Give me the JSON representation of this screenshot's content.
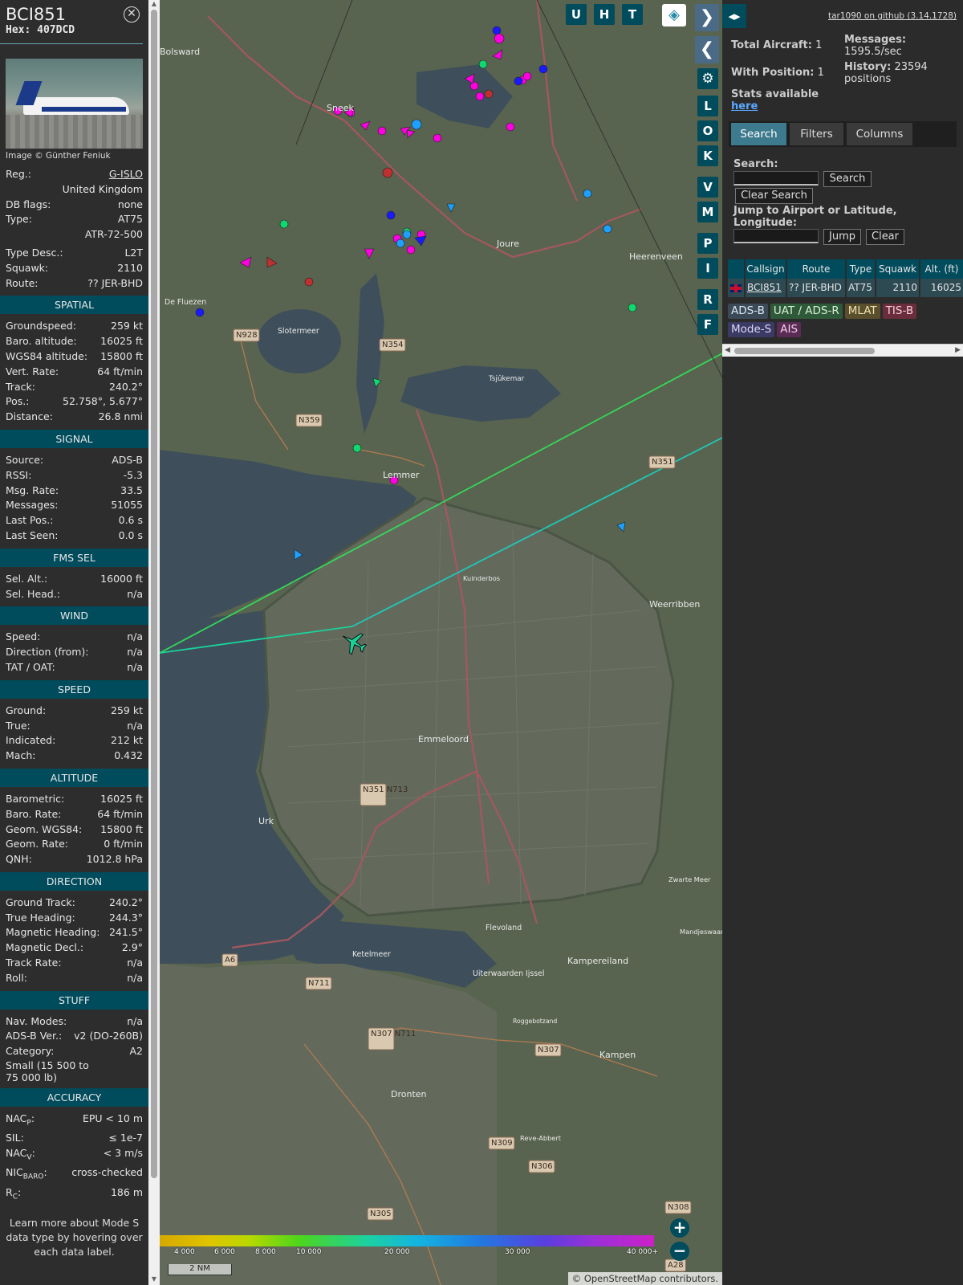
{
  "sidebar": {
    "callsign": "BCI851",
    "hex_label": "Hex:",
    "hex": "407DCD",
    "photo_credit": "Image © Günther Feniuk",
    "info": [
      {
        "k": "Reg.:",
        "v": "G-ISLO",
        "link": true
      },
      {
        "k": "",
        "v": "United Kingdom"
      },
      {
        "k": "DB flags:",
        "v": "none"
      },
      {
        "k": "Type:",
        "v": "AT75"
      },
      {
        "k": "",
        "v": "ATR-72-500"
      },
      {
        "k": "Type Desc.:",
        "v": "L2T"
      },
      {
        "k": "Squawk:",
        "v": "2110"
      },
      {
        "k": "Route:",
        "v": "?? JER-BHD"
      }
    ],
    "sections": [
      {
        "title": "SPATIAL",
        "rows": [
          {
            "k": "Groundspeed:",
            "v": "259 kt"
          },
          {
            "k": "Baro. altitude:",
            "v": "16025 ft"
          },
          {
            "k": "WGS84 altitude:",
            "v": "15800 ft"
          },
          {
            "k": "Vert. Rate:",
            "v": "64 ft/min"
          },
          {
            "k": "Track:",
            "v": "240.2°"
          },
          {
            "k": "Pos.:",
            "v": "52.758°, 5.677°"
          },
          {
            "k": "Distance:",
            "v": "26.8 nmi"
          }
        ]
      },
      {
        "title": "SIGNAL",
        "rows": [
          {
            "k": "Source:",
            "v": "ADS-B"
          },
          {
            "k": "RSSI:",
            "v": "-5.3"
          },
          {
            "k": "Msg. Rate:",
            "v": "33.5"
          },
          {
            "k": "Messages:",
            "v": "51055"
          },
          {
            "k": "Last Pos.:",
            "v": "0.6 s"
          },
          {
            "k": "Last Seen:",
            "v": "0.0 s"
          }
        ]
      },
      {
        "title": "FMS SEL",
        "rows": [
          {
            "k": "Sel. Alt.:",
            "v": "16000 ft"
          },
          {
            "k": "Sel. Head.:",
            "v": "n/a"
          }
        ]
      },
      {
        "title": "WIND",
        "rows": [
          {
            "k": "Speed:",
            "v": "n/a"
          },
          {
            "k": "Direction (from):",
            "v": "n/a"
          },
          {
            "k": "TAT / OAT:",
            "v": "n/a"
          }
        ]
      },
      {
        "title": "SPEED",
        "rows": [
          {
            "k": "Ground:",
            "v": "259 kt"
          },
          {
            "k": "True:",
            "v": "n/a"
          },
          {
            "k": "Indicated:",
            "v": "212 kt"
          },
          {
            "k": "Mach:",
            "v": "0.432"
          }
        ]
      },
      {
        "title": "ALTITUDE",
        "rows": [
          {
            "k": "Barometric:",
            "v": "16025 ft"
          },
          {
            "k": "Baro. Rate:",
            "v": "64 ft/min"
          },
          {
            "k": "Geom. WGS84:",
            "v": "15800 ft"
          },
          {
            "k": "Geom. Rate:",
            "v": "0 ft/min"
          },
          {
            "k": "QNH:",
            "v": "1012.8 hPa"
          }
        ]
      },
      {
        "title": "DIRECTION",
        "rows": [
          {
            "k": "Ground Track:",
            "v": "240.2°"
          },
          {
            "k": "True Heading:",
            "v": "244.3°"
          },
          {
            "k": "Magnetic Heading:",
            "v": "241.5°"
          },
          {
            "k": "Magnetic Decl.:",
            "v": "2.9°"
          },
          {
            "k": "Track Rate:",
            "v": "n/a"
          },
          {
            "k": "Roll:",
            "v": "n/a"
          }
        ]
      },
      {
        "title": "STUFF",
        "rows": [
          {
            "k": "Nav. Modes:",
            "v": "n/a"
          },
          {
            "k": "ADS-B Ver.:",
            "v": "v2 (DO-260B)"
          },
          {
            "k": "Category:",
            "v": "A2"
          }
        ]
      },
      {
        "title": "ACCURACY",
        "rows": [
          {
            "k": "NAC",
            "sub": "P",
            "v": "EPU < 10 m"
          },
          {
            "k": "SIL:",
            "v": "≤ 1e-7"
          },
          {
            "k": "NAC",
            "sub": "V",
            "v": "< 3 m/s"
          },
          {
            "k": "NIC",
            "sub": "BARO",
            "v": "cross-checked"
          },
          {
            "k": "R",
            "sub": "C",
            "v": "186 m"
          }
        ]
      }
    ],
    "category_desc": "Small (15 500 to 75 000 lb)",
    "note": "Learn more about Mode S data type by hovering over each data label."
  },
  "map": {
    "buttons_top": [
      "U",
      "H",
      "T"
    ],
    "buttons_side": [
      "L",
      "O",
      "K",
      "V",
      "M",
      "P",
      "I",
      "R",
      "F"
    ],
    "place_labels": [
      {
        "t": "Bolsward"
      },
      {
        "t": "Sneek"
      },
      {
        "t": "Joure"
      },
      {
        "t": "Heerenveen"
      },
      {
        "t": "Lemmer"
      },
      {
        "t": "Emmeloord"
      },
      {
        "t": "Urk"
      },
      {
        "t": "Dronten"
      },
      {
        "t": "Kampen"
      },
      {
        "t": "Kampereiland"
      },
      {
        "t": "Weerribben"
      },
      {
        "t": "Slotermeer"
      },
      {
        "t": "Tsjûkemar"
      },
      {
        "t": "De Fluezen"
      },
      {
        "t": "Ketelmeer"
      },
      {
        "t": "Flevoland"
      },
      {
        "t": "Uiterwaarden Ijssel"
      },
      {
        "t": "Roggebotzand"
      },
      {
        "t": "Reve-Abbert"
      },
      {
        "t": "Kuinderbos"
      },
      {
        "t": "Zwarte Meer"
      },
      {
        "t": "Mandjeswaard"
      }
    ],
    "road_labels": [
      "A6",
      "N928",
      "N354",
      "N359",
      "N351",
      "N351 N713",
      "N711",
      "N307 N711",
      "N307",
      "N309",
      "N306",
      "N305",
      "N308",
      "A28"
    ],
    "legend_labels": [
      "4 000",
      "6 000",
      "8 000",
      "10 000",
      "20 000",
      "30 000",
      "40 000+"
    ],
    "scale": "2 NM",
    "attribution": "© OpenStreetMap contributors."
  },
  "panel": {
    "github": "tar1090 on github (3.14.1728)",
    "total_label": "Total Aircraft:",
    "total": "1",
    "withpos_label": "With Position:",
    "withpos": "1",
    "messages_label": "Messages:",
    "messages": "1595.5/sec",
    "history_label": "History:",
    "history": "23594 positions",
    "stats_label": "Stats available",
    "stats_link": "here",
    "tabs": [
      "Search",
      "Filters",
      "Columns"
    ],
    "search_label": "Search:",
    "search_btn": "Search",
    "clear_search_btn": "Clear Search",
    "jump_label": "Jump to Airport or Latitude, Longitude:",
    "jump_btn": "Jump",
    "clear_btn": "Clear",
    "table": {
      "headers": [
        "",
        "Callsign",
        "Route",
        "Type",
        "Squawk",
        "Alt. (ft)"
      ],
      "rows": [
        [
          "",
          "BCI851",
          "?? JER-BHD",
          "AT75",
          "2110",
          "16025"
        ]
      ]
    },
    "tags": [
      {
        "t": "ADS-B",
        "bg": "#3c4a58",
        "fg": "#dce8f5"
      },
      {
        "t": "UAT / ADS-R",
        "bg": "#2f5a3a",
        "fg": "#d8efd8"
      },
      {
        "t": "MLAT",
        "bg": "#5a4f2c",
        "fg": "#f0e0b0"
      },
      {
        "t": "TIS-B",
        "bg": "#6a2d3d",
        "fg": "#f5d0d8"
      },
      {
        "t": "Mode-S",
        "bg": "#3b3a64",
        "fg": "#dcd8f5"
      },
      {
        "t": "AIS",
        "bg": "#5a2b55",
        "fg": "#f0d0ea"
      }
    ]
  }
}
